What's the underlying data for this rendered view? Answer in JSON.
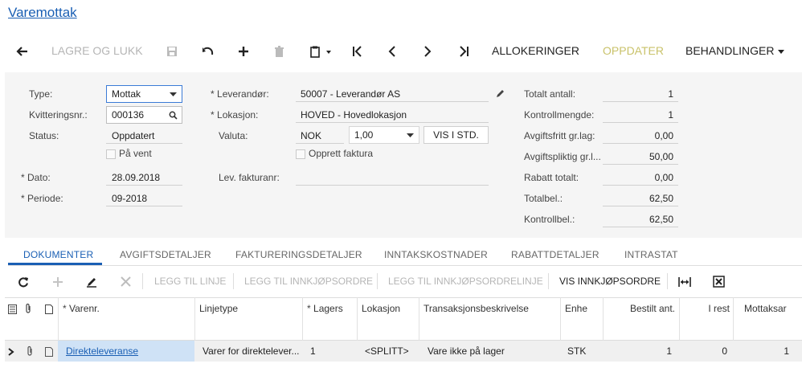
{
  "title": "Varemottak",
  "toolbar": {
    "lagre_og_lukk": "LAGRE OG LUKK",
    "allokeringer": "ALLOKERINGER",
    "oppdater": "OPPDATER",
    "behandlinger": "BEHANDLINGER"
  },
  "form": {
    "type_label": "Type:",
    "type_value": "Mottak",
    "kvittering_label": "Kvitteringsnr.:",
    "kvittering_value": "000136",
    "status_label": "Status:",
    "status_value": "Oppdatert",
    "pa_vent": "På vent",
    "dato_label": "Dato:",
    "dato_value": "28.09.2018",
    "periode_label": "Periode:",
    "periode_value": "09-2018",
    "leverandor_label": "Leverandør:",
    "leverandor_value": "50007 - Leverandør AS",
    "lokasjon_label": "Lokasjon:",
    "lokasjon_value": "HOVED - Hovedlokasjon",
    "valuta_label": "Valuta:",
    "valuta_value": "NOK",
    "kurs_value": "1,00",
    "vis_i_std": "VIS I STD.",
    "opprett_faktura": "Opprett faktura",
    "lev_fakturanr_label": "Lev. fakturanr:",
    "totals": [
      {
        "label": "Totalt antall:",
        "value": "1"
      },
      {
        "label": "Kontrollmengde:",
        "value": "1"
      },
      {
        "label": "Avgiftsfritt gr.lag:",
        "value": "0,00"
      },
      {
        "label": "Avgiftspliktig gr.l...",
        "value": "50,00"
      },
      {
        "label": "Rabatt totalt:",
        "value": "0,00"
      },
      {
        "label": "Totalbel.:",
        "value": "62,50"
      },
      {
        "label": "Kontrollbel.:",
        "value": "62,50"
      }
    ]
  },
  "tabs": [
    "DOKUMENTER",
    "AVGIFTSDETALJER",
    "FAKTURERINGSDETALJER",
    "INNTAKSKOSTNADER",
    "RABATTDETALJER",
    "INTRASTAT"
  ],
  "grid_toolbar": {
    "legg_til_linje": "LEGG TIL LINJE",
    "legg_til_innkjopsordre": "LEGG TIL INNKJØPSORDRE",
    "legg_til_innkjopsordrelinje": "LEGG TIL INNKJØPSORDRELINJE",
    "vis_innkjopsordre": "VIS INNKJØPSORDRE"
  },
  "grid": {
    "headers": [
      "Varenr.",
      "Linjetype",
      "Lagers",
      "Lokasjon",
      "Transaksjonsbeskrivelse",
      "Enhe",
      "Bestilt ant.",
      "I rest",
      "Mottaksar"
    ],
    "row": [
      "Direkteleveranse",
      "Varer for direktelever...",
      "1",
      "<SPLITT>",
      "Vare ikke på lager",
      "STK",
      "1",
      "0",
      "1"
    ]
  }
}
